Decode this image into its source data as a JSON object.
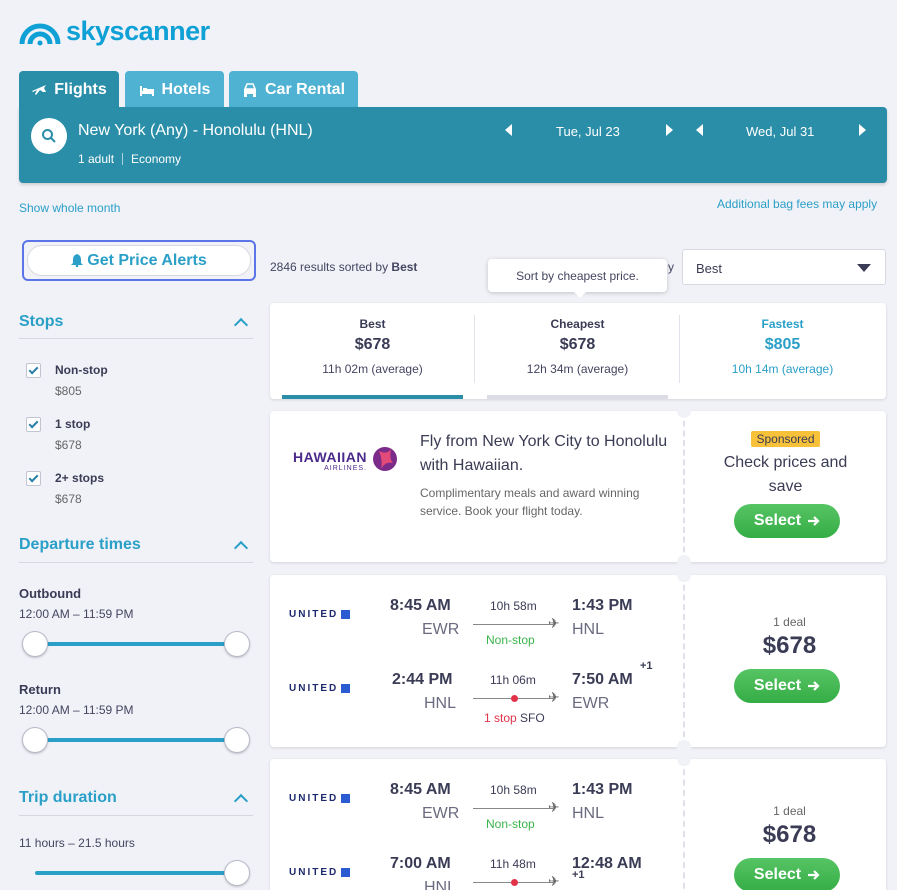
{
  "brand": {
    "name": "skyscanner"
  },
  "tabs": [
    {
      "label": "Flights",
      "icon": "plane-icon"
    },
    {
      "label": "Hotels",
      "icon": "bed-icon"
    },
    {
      "label": "Car Rental",
      "icon": "car-icon"
    }
  ],
  "search": {
    "route": "New York (Any) - Honolulu (HNL)",
    "adults": "1 adult",
    "cabin": "Economy",
    "depart_date": "Tue, Jul 23",
    "return_date": "Wed, Jul 31"
  },
  "links": {
    "whole_month": "Show whole month",
    "bag_fees": "Additional bag fees may apply"
  },
  "price_alerts": {
    "label": "Get Price Alerts"
  },
  "filters": {
    "stops_title": "Stops",
    "stops": [
      {
        "label": "Non-stop",
        "price": "$805",
        "checked": true
      },
      {
        "label": "1 stop",
        "price": "$678",
        "checked": true
      },
      {
        "label": "2+ stops",
        "price": "$678",
        "checked": true
      }
    ],
    "departure_title": "Departure times",
    "outbound_label": "Outbound",
    "outbound_range": "12:00 AM – 11:59 PM",
    "return_label": "Return",
    "return_range": "12:00 AM – 11:59 PM",
    "duration_title": "Trip duration",
    "duration_range": "11 hours – 21.5 hours"
  },
  "results": {
    "count_prefix": "2846 results sorted by",
    "sorted_by": "Best",
    "sort_partial": "y",
    "sort_select_value": "Best",
    "tooltip": "Sort by cheapest price."
  },
  "sort_tabs": [
    {
      "name": "Best",
      "price": "$678",
      "duration": "11h 02m (average)"
    },
    {
      "name": "Cheapest",
      "price": "$678",
      "duration": "12h 34m (average)"
    },
    {
      "name": "Fastest",
      "price": "$805",
      "duration": "10h 14m (average)"
    }
  ],
  "ad": {
    "logo_main": "HAWAIIAN",
    "logo_sub": "AIRLINES.",
    "headline": "Fly from New York City to Honolulu with Hawaiian.",
    "body": "Complimentary meals and award winning service. Book your flight today.",
    "badge": "Sponsored",
    "cta_text": "Check prices and save",
    "button": "Select"
  },
  "flights": [
    {
      "legs": [
        {
          "airline": "UNITED",
          "dep_time": "8:45 AM",
          "dep_code": "EWR",
          "duration": "10h 58m",
          "stops": "Non-stop",
          "stop_type": "nonstop",
          "stop_via": "",
          "arr_time": "1:43 PM",
          "arr_code": "HNL",
          "plus": ""
        },
        {
          "airline": "UNITED",
          "dep_time": "2:44 PM",
          "dep_code": "HNL",
          "duration": "11h 06m",
          "stops": "1 stop",
          "stop_type": "stop",
          "stop_via": "SFO",
          "arr_time": "7:50 AM",
          "arr_code": "EWR",
          "plus": "+1"
        }
      ],
      "deals": "1 deal",
      "price": "$678",
      "button": "Select"
    },
    {
      "legs": [
        {
          "airline": "UNITED",
          "dep_time": "8:45 AM",
          "dep_code": "EWR",
          "duration": "10h 58m",
          "stops": "Non-stop",
          "stop_type": "nonstop",
          "stop_via": "",
          "arr_time": "1:43 PM",
          "arr_code": "HNL",
          "plus": ""
        },
        {
          "airline": "UNITED",
          "dep_time": "7:00 AM",
          "dep_code": "HNL",
          "duration": "11h 48m",
          "stops": "",
          "stop_type": "stop",
          "stop_via": "",
          "arr_time": "12:48 AM",
          "arr_code": "",
          "plus": "+1"
        }
      ],
      "deals": "1 deal",
      "price": "$678",
      "button": "Select"
    }
  ],
  "colors": {
    "primary": "#2a8ea8",
    "accent": "#2a9fc7",
    "green": "#3bb54a",
    "red": "#e0334a",
    "sponsored": "#f7c139"
  }
}
